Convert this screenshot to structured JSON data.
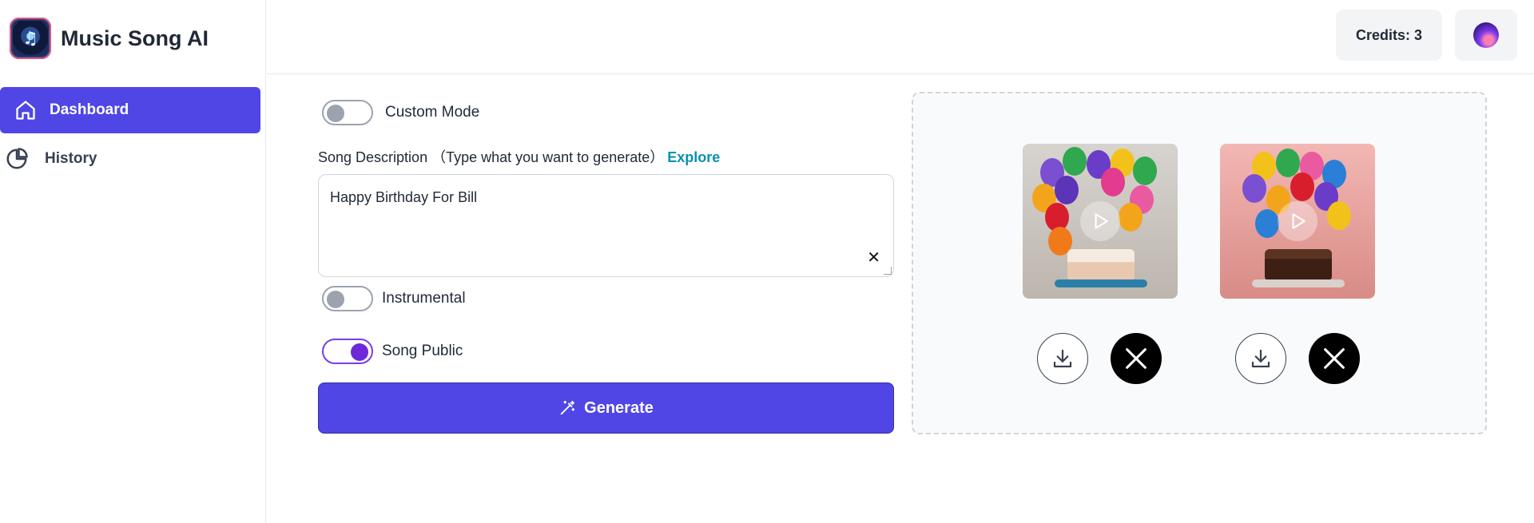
{
  "app": {
    "name": "Music Song AI",
    "logo_icon": "music-note-icon"
  },
  "sidebar": {
    "items": [
      {
        "label": "Dashboard",
        "icon": "home-icon",
        "active": true
      },
      {
        "label": "History",
        "icon": "pie-chart-icon",
        "active": false
      }
    ]
  },
  "header": {
    "credits": "Credits: 3",
    "avatar_icon": "user-avatar"
  },
  "form": {
    "custom_mode": {
      "label": "Custom Mode",
      "enabled": false
    },
    "description_label": "Song Description （Type what you want to generate）",
    "explore_link": "Explore",
    "description_value": "Happy Birthday For Bill",
    "instrumental": {
      "label": "Instrumental",
      "enabled": false
    },
    "song_public": {
      "label": "Song Public",
      "enabled": true
    },
    "generate_label": "Generate"
  },
  "results": {
    "songs": [
      {
        "thumbnail": "birthday-cake-balloons",
        "actions": [
          "download-icon",
          "x-share-icon"
        ]
      },
      {
        "thumbnail": "birthday-cake-balloons-pink",
        "actions": [
          "download-icon",
          "x-share-icon"
        ]
      }
    ]
  },
  "colors": {
    "accent": "#4f46e5",
    "link": "#0891b2",
    "toggle_on": "#6d28d9"
  }
}
